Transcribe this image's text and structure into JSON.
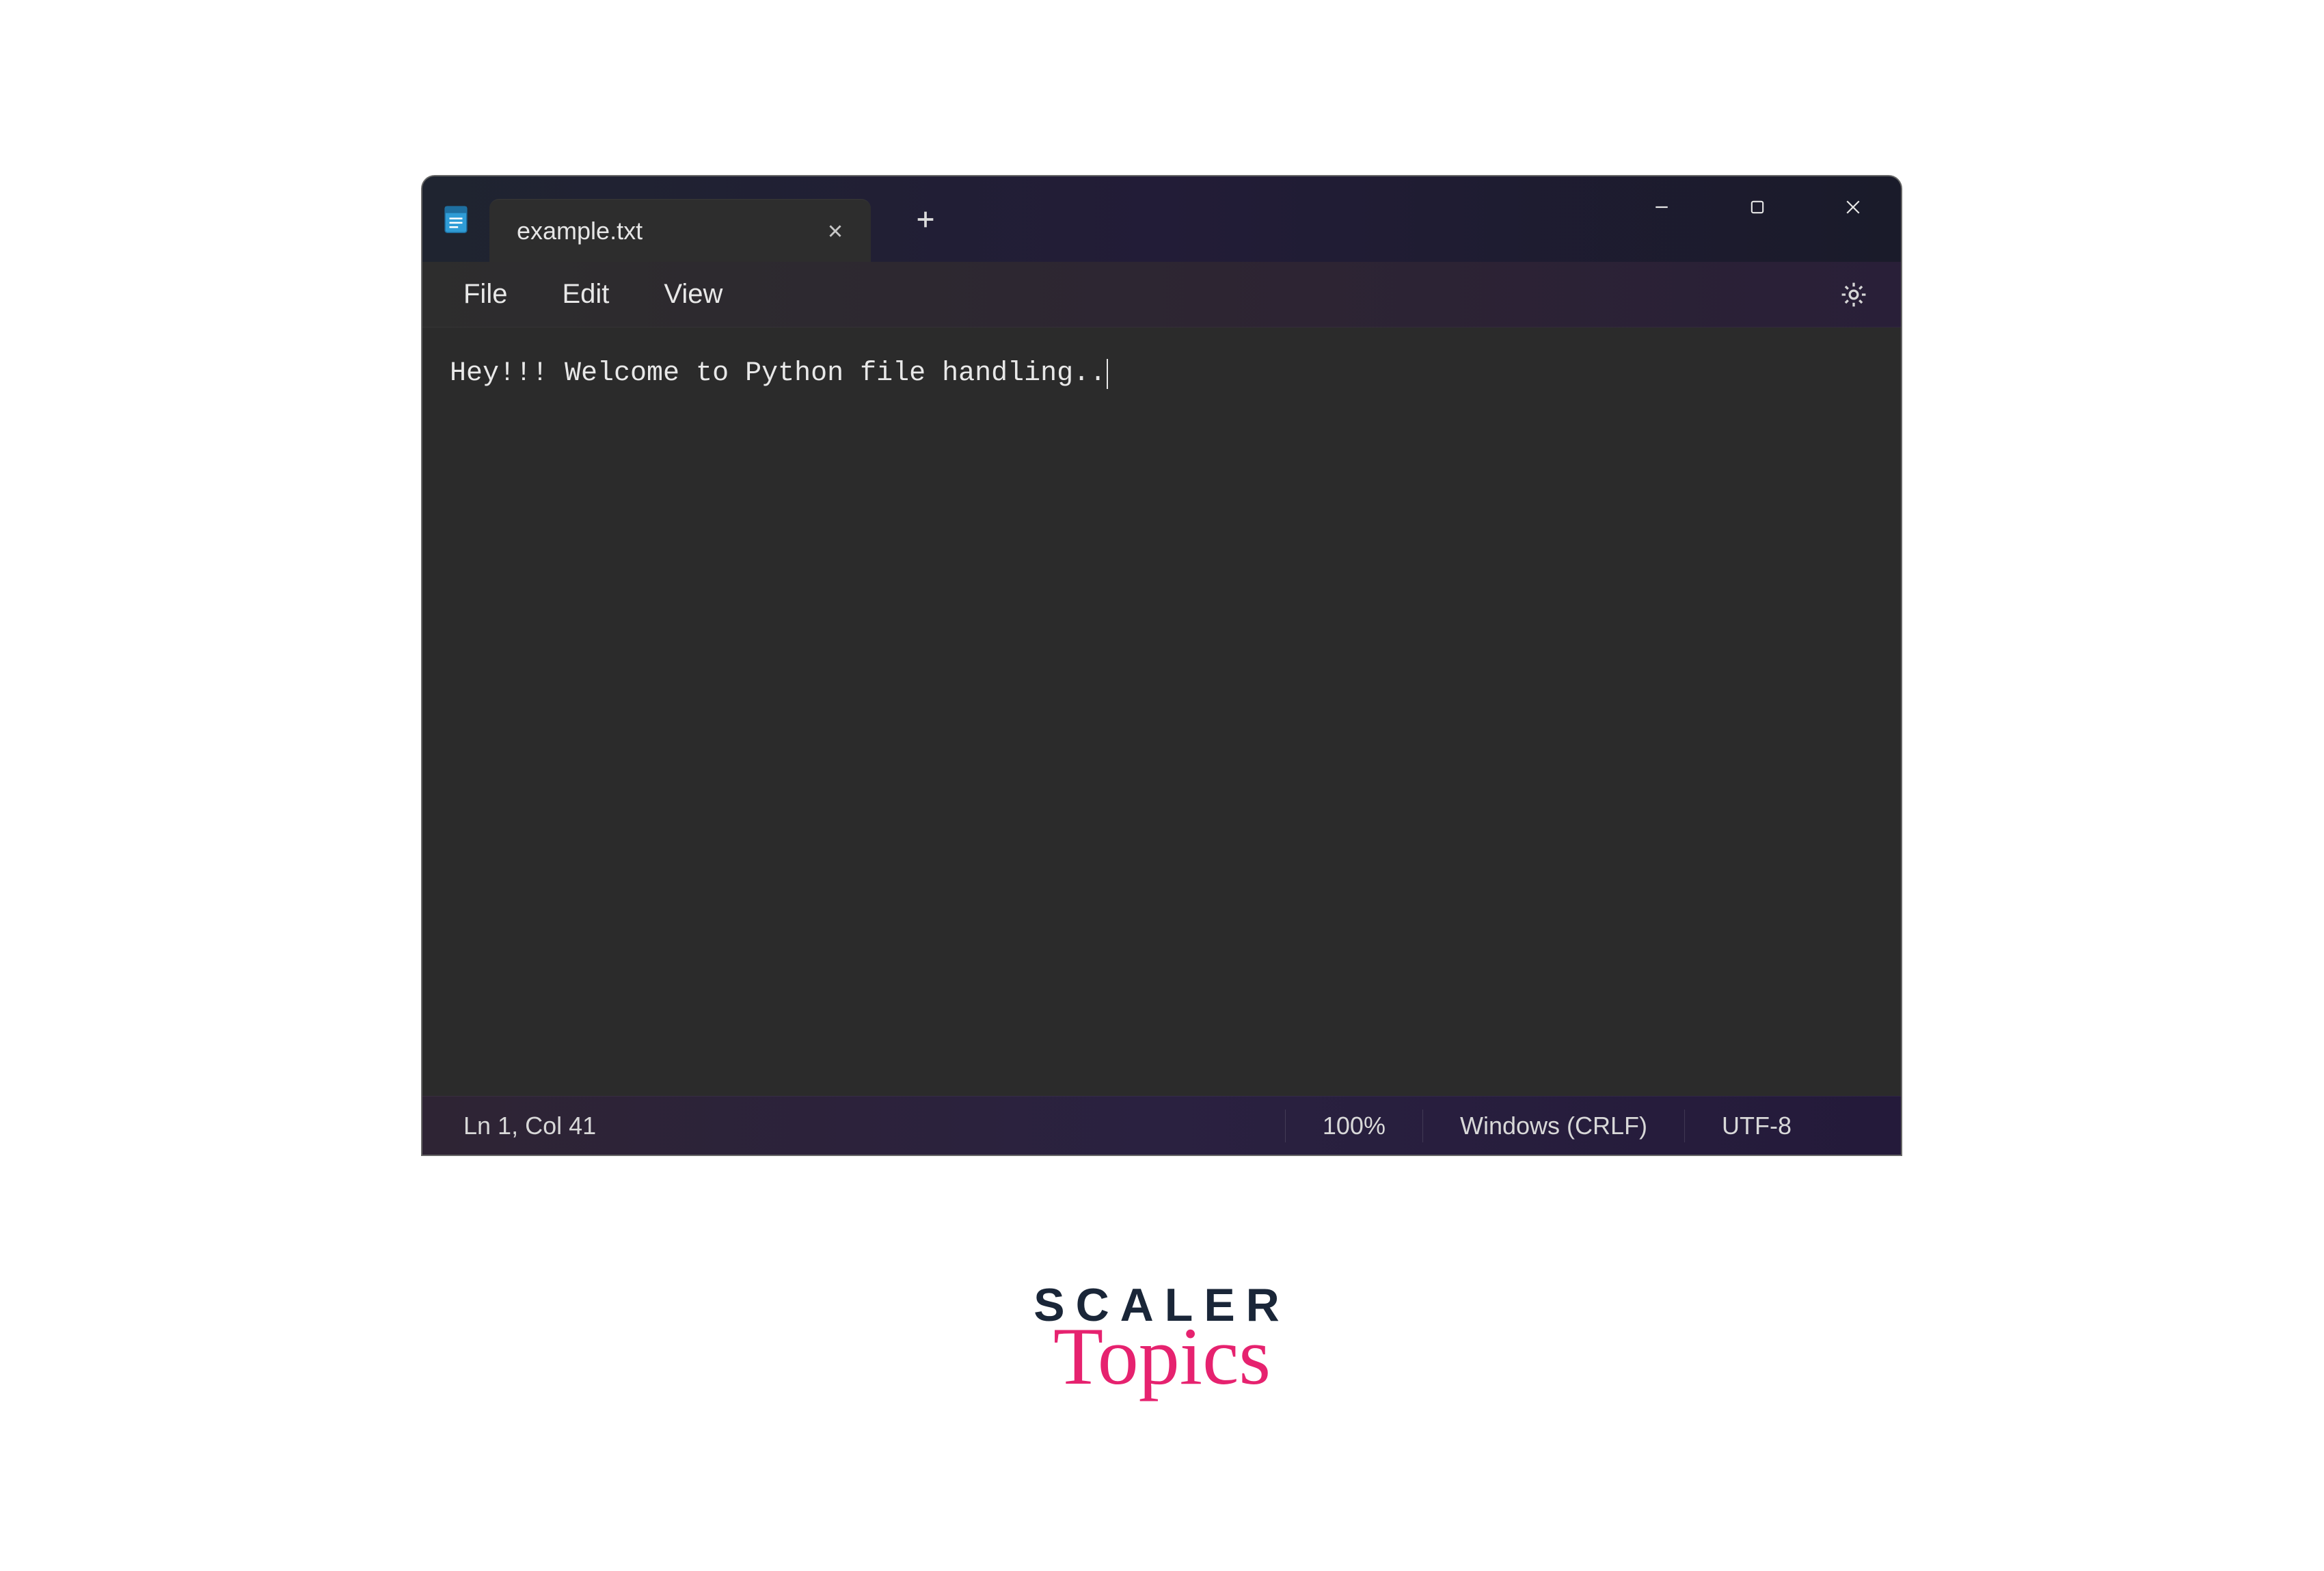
{
  "titlebar": {
    "tab_title": "example.txt"
  },
  "menubar": {
    "file": "File",
    "edit": "Edit",
    "view": "View"
  },
  "editor": {
    "content": "Hey!!! Welcome to Python file handling.."
  },
  "statusbar": {
    "position": "Ln 1, Col 41",
    "zoom": "100%",
    "line_ending": "Windows (CRLF)",
    "encoding": "UTF-8"
  },
  "brand": {
    "top": "SCALER",
    "bottom": "Topics"
  },
  "icons": {
    "app": "notepad-icon",
    "close_tab": "close-icon",
    "new_tab": "plus-icon",
    "minimize": "minimize-icon",
    "maximize": "maximize-icon",
    "close_window": "close-icon",
    "settings": "gear-icon"
  }
}
